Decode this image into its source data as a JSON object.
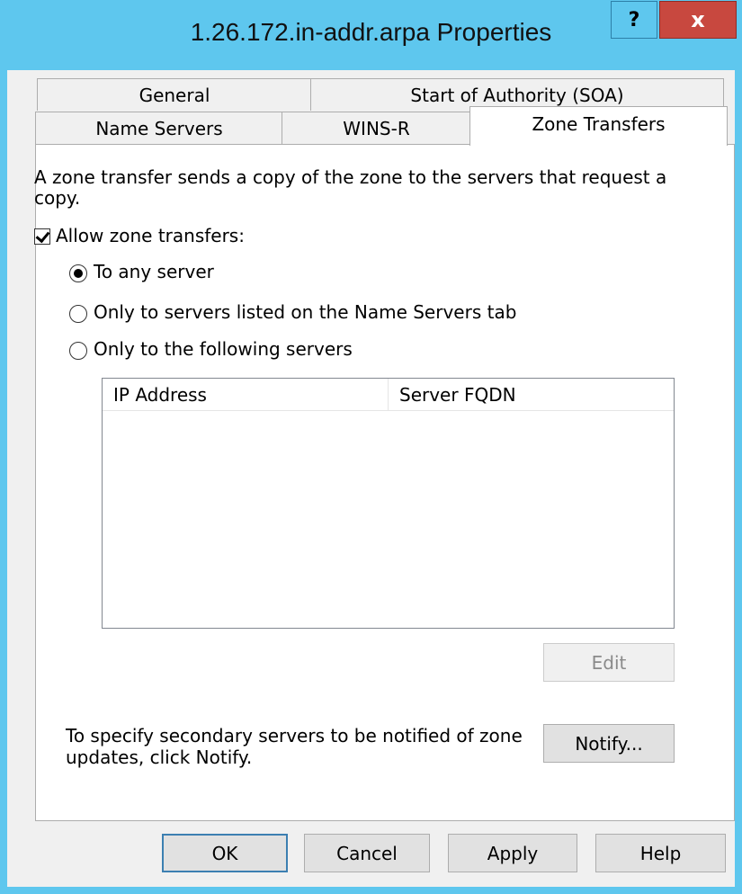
{
  "window": {
    "title": "1.26.172.in-addr.arpa Properties",
    "help_glyph": "?",
    "close_glyph": "x"
  },
  "tabs": {
    "row1": [
      "General",
      "Start of Authority (SOA)"
    ],
    "row2": [
      "Name Servers",
      "WINS-R",
      "Zone Transfers"
    ],
    "active": "Zone Transfers"
  },
  "panel": {
    "description_line1": "A zone transfer sends a copy of the zone to the servers that request a",
    "description_line2": "copy.",
    "allow_label": "Allow zone transfers:",
    "allow_checked": true,
    "options": [
      {
        "label": "To any server",
        "selected": true
      },
      {
        "label": "Only to servers listed on the Name Servers tab",
        "selected": false
      },
      {
        "label": "Only to the following servers",
        "selected": false
      }
    ],
    "list_columns": [
      "IP Address",
      "Server FQDN"
    ],
    "list_rows": [],
    "edit_label": "Edit",
    "notify_text_line1": "To specify secondary servers to be notified of zone",
    "notify_text_line2": "updates, click Notify.",
    "notify_label": "Notify..."
  },
  "footer": {
    "ok": "OK",
    "cancel": "Cancel",
    "apply": "Apply",
    "help": "Help"
  },
  "colors": {
    "titlebar": "#5ec7ee",
    "close": "#c8483f",
    "dialog_bg": "#f0f0f0"
  }
}
